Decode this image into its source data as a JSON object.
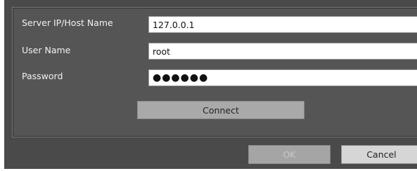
{
  "form": {
    "fields": [
      {
        "label": "Server IP/Host Name",
        "value": "127.0.0.1"
      },
      {
        "label": "User Name",
        "value": "root"
      },
      {
        "label": "Password",
        "value": "●●●●●●"
      }
    ],
    "connect_label": "Connect"
  },
  "dialog": {
    "ok_label": "OK",
    "cancel_label": "Cancel",
    "ok_enabled": false
  },
  "colors": {
    "background": "#4a4a4a",
    "panel": "#555555",
    "label_text": "#f2f2f2",
    "disabled_button": "#a5a5a5",
    "button": "#d6d6d6"
  }
}
